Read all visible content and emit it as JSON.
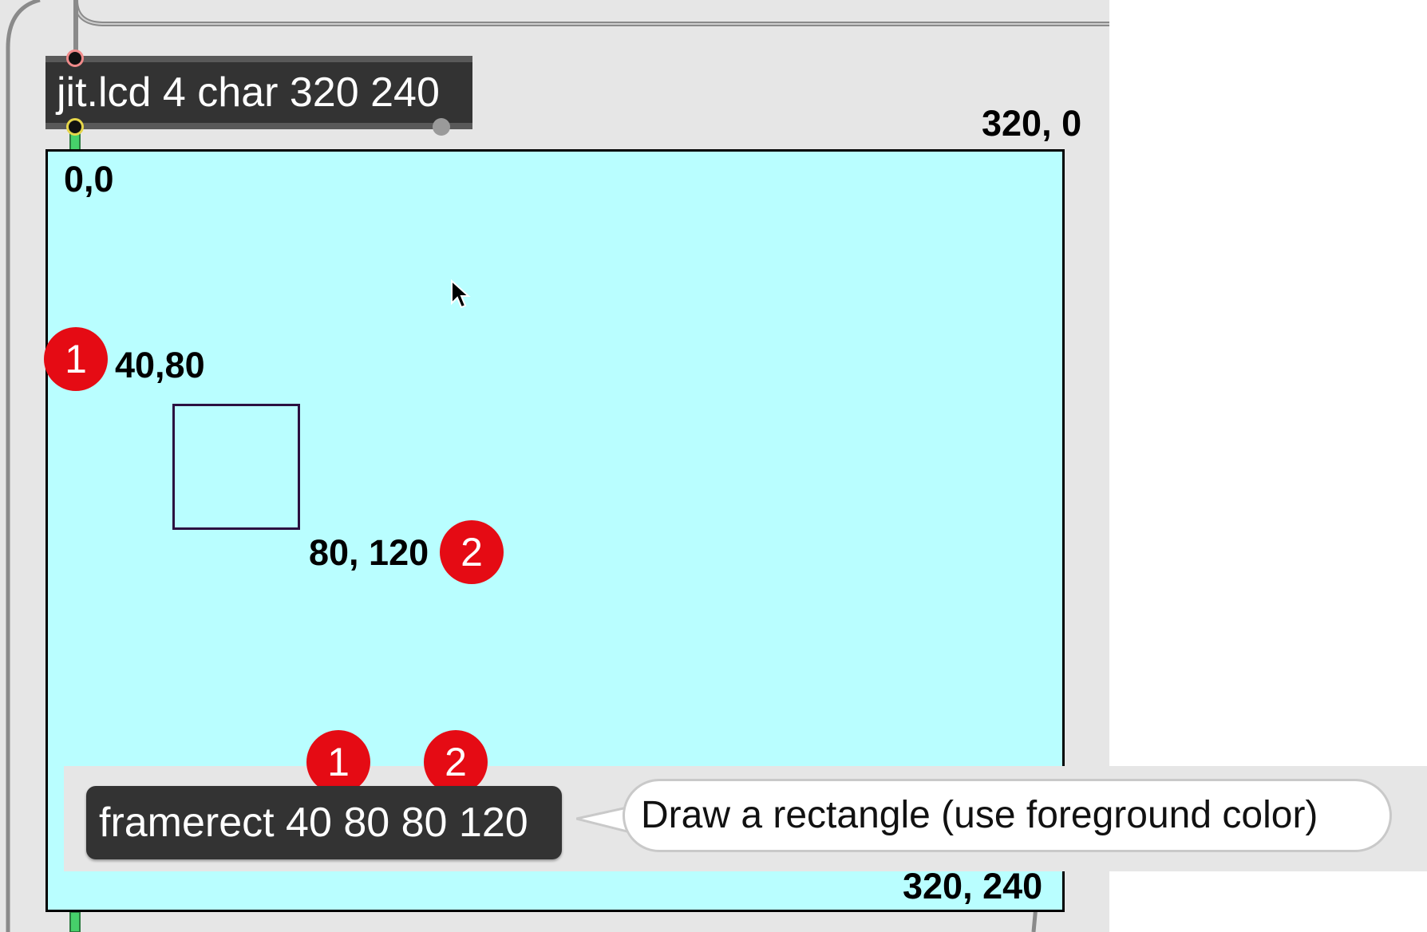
{
  "lcd_object": {
    "label": "jit.lcd 4 char 320 240"
  },
  "display": {
    "background": "#b9feff",
    "corner_labels": {
      "top_left": "0,0",
      "top_right": "320, 0",
      "bottom_right": "320, 240"
    },
    "rect_labels": {
      "start": "40,80",
      "end": "80, 120"
    }
  },
  "badges": {
    "one": "1",
    "two": "2",
    "color": "#e50b14"
  },
  "message_box": {
    "label": "framerect 40 80 80 120"
  },
  "comment_bubble": {
    "text": "Draw a rectangle (use foreground color)"
  },
  "colors": {
    "object_fill": "#333333",
    "patch_background": "#e6e6e6",
    "rect_stroke": "#2b1040"
  }
}
